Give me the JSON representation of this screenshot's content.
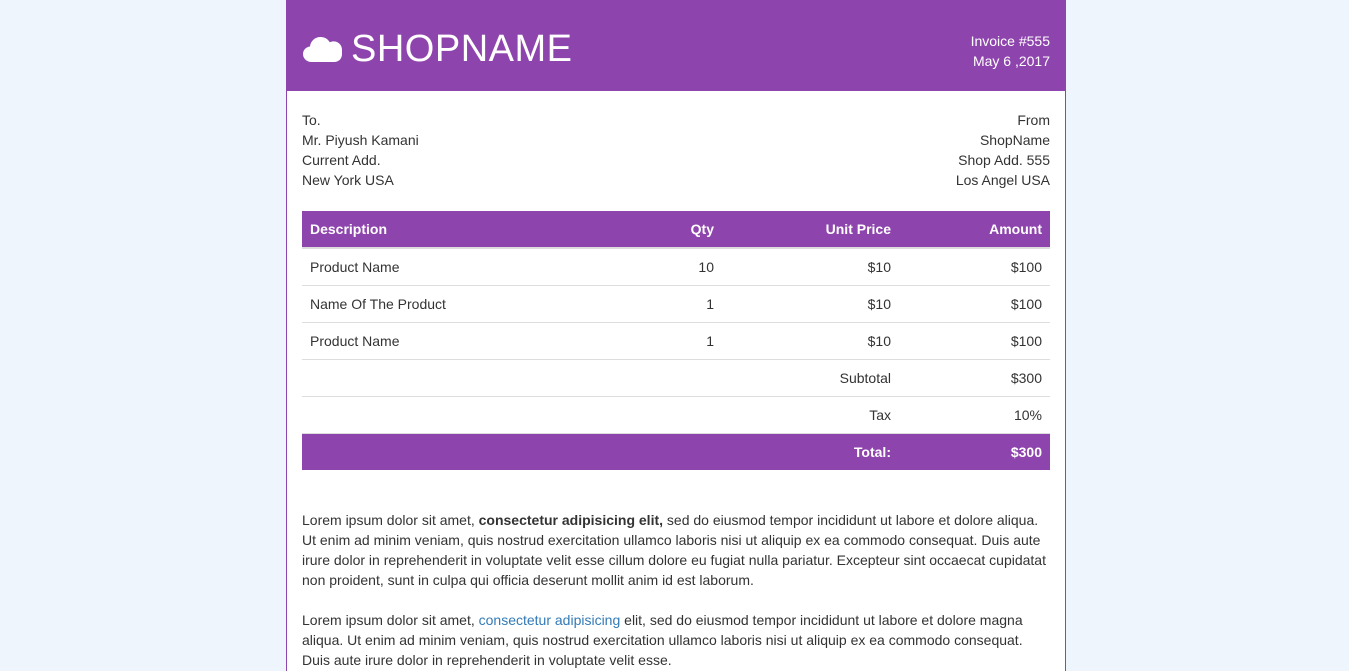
{
  "header": {
    "brand": "SHOPNAME",
    "logo_icon": "cloud-icon",
    "invoice_number": "Invoice #555",
    "invoice_date": "May 6 ,2017",
    "accent_color": "#8e44ad"
  },
  "to": {
    "label": "To.",
    "name": "Mr. Piyush Kamani",
    "line1": "Current Add.",
    "line2": "New York USA"
  },
  "from": {
    "label": "From",
    "name": "ShopName",
    "line1": "Shop Add. 555",
    "line2": "Los Angel USA"
  },
  "table": {
    "headers": {
      "description": "Description",
      "qty": "Qty",
      "unit_price": "Unit Price",
      "amount": "Amount"
    },
    "rows": [
      {
        "description": "Product Name",
        "qty": "10",
        "unit_price": "$10",
        "amount": "$100"
      },
      {
        "description": "Name Of The Product",
        "qty": "1",
        "unit_price": "$10",
        "amount": "$100"
      },
      {
        "description": "Product Name",
        "qty": "1",
        "unit_price": "$10",
        "amount": "$100"
      }
    ],
    "subtotal_label": "Subtotal",
    "subtotal_value": "$300",
    "tax_label": "Tax",
    "tax_value": "10%",
    "total_label": "Total:",
    "total_value": "$300"
  },
  "notes": {
    "p1_start": "Lorem ipsum dolor sit amet, ",
    "p1_bold": "consectetur adipisicing elit,",
    "p1_end": " sed do eiusmod tempor incididunt ut labore et dolore aliqua. Ut enim ad minim veniam, quis nostrud exercitation ullamco laboris nisi ut aliquip ex ea commodo consequat. Duis aute irure dolor in reprehenderit in voluptate velit esse cillum dolore eu fugiat nulla pariatur. Excepteur sint occaecat cupidatat non proident, sunt in culpa qui officia deserunt mollit anim id est laborum.",
    "p2_start": "Lorem ipsum dolor sit amet, ",
    "p2_link": "consectetur adipisicing",
    "p2_end": " elit, sed do eiusmod tempor incididunt ut labore et dolore magna aliqua. Ut enim ad minim veniam, quis nostrud exercitation ullamco laboris nisi ut aliquip ex ea commodo consequat. Duis aute irure dolor in reprehenderit in voluptate velit esse."
  }
}
